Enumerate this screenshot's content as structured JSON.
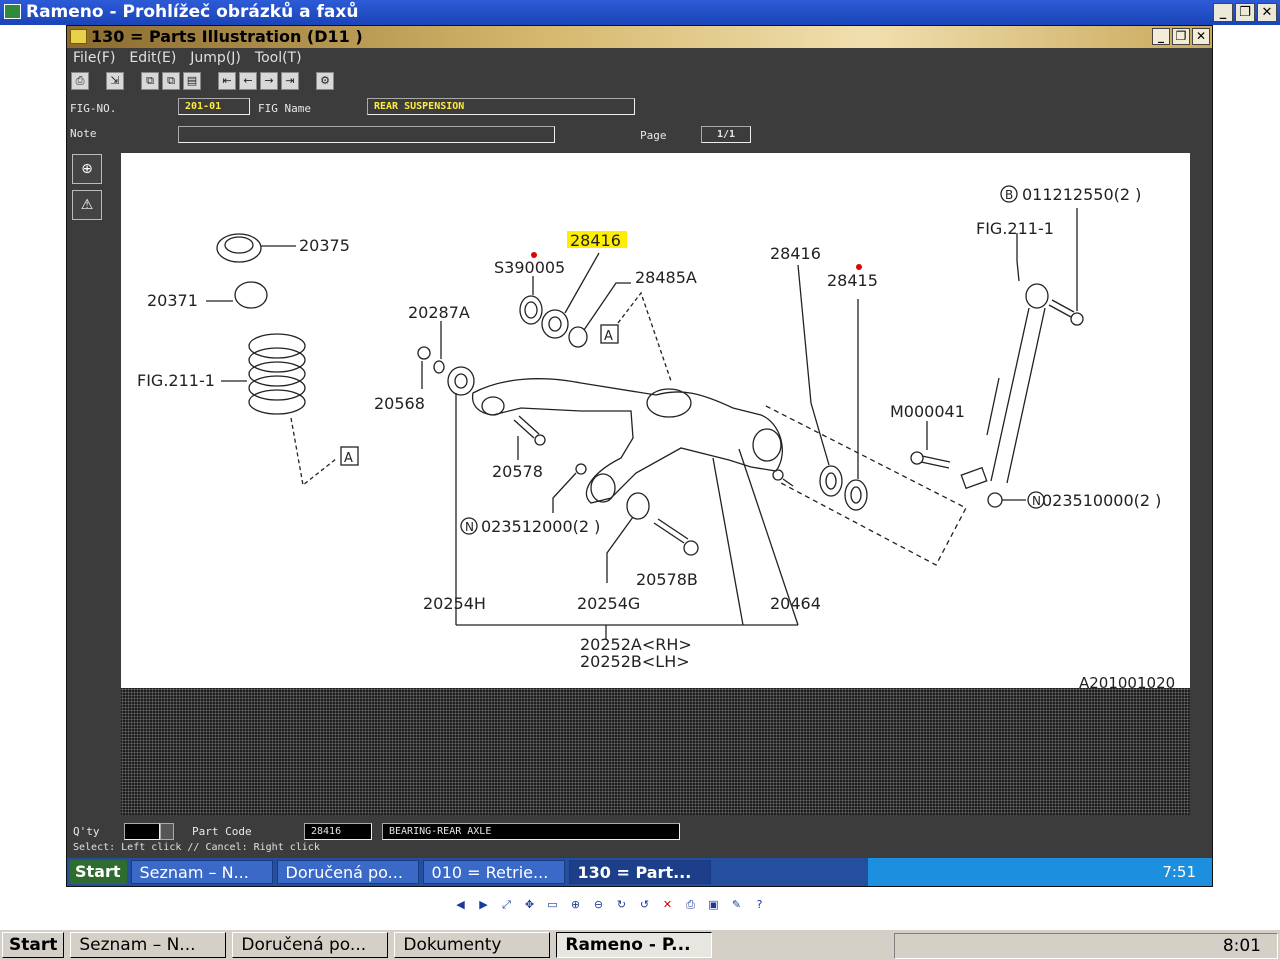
{
  "outer_window": {
    "title": "Rameno - Prohlížeč obrázků a faxů"
  },
  "inner_window": {
    "title": "130 = Parts Illustration (D11   )"
  },
  "menu": [
    "File(F)",
    "Edit(E)",
    "Jump(J)",
    "Tool(T)"
  ],
  "form": {
    "fig_no_label": "FIG-NO.",
    "fig_no_value": "201-01",
    "fig_name_label": "FIG Name",
    "fig_name_value": "REAR SUSPENSION",
    "note_label": "Note",
    "note_value": "",
    "page_label": "Page",
    "page_value": "1/1",
    "qty_label": "Q'ty",
    "qty_value": "",
    "part_code_label": "Part Code",
    "part_code_value": "28416",
    "part_desc_value": "BEARING-REAR AXLE",
    "status_text": "Select: Left click // Cancel: Right click"
  },
  "drawing": {
    "labels": {
      "p20375": "20375",
      "p20371": "20371",
      "fig2111_left": "FIG.211-1",
      "p28416_hl": "28416",
      "s390005": "S390005",
      "p28485a": "28485A",
      "p20287a": "20287A",
      "p20568": "20568",
      "p20578": "20578",
      "n023512000": "023512000(2 )",
      "p20578b": "20578B",
      "p20254h": "20254H",
      "p20254g": "20254G",
      "p20464": "20464",
      "p20252a": "20252A<RH>",
      "p20252b": "20252B<LH>",
      "p28416_r": "28416",
      "p28415": "28415",
      "b011212550": "011212550(2 )",
      "fig2111_right": "FIG.211-1",
      "m000041": "M000041",
      "n023510000": "023510000(2 )",
      "ref_a": "A",
      "ref_b": "B",
      "ref_n": "N",
      "drawing_code": "A201001020"
    },
    "highlight_color": "#ffee00",
    "marker_color": "#e00000"
  },
  "inner_taskbar": {
    "start": "Start",
    "buttons": [
      "Seznam – N...",
      "Doručená po...",
      "010 = Retrie...",
      "130 = Part..."
    ],
    "clock": "7:51"
  },
  "outer_taskbar": {
    "start": "Start",
    "buttons": [
      "Seznam – N...",
      "Doručená po...",
      "Dokumenty",
      "Rameno - P..."
    ],
    "clock": "8:01"
  }
}
